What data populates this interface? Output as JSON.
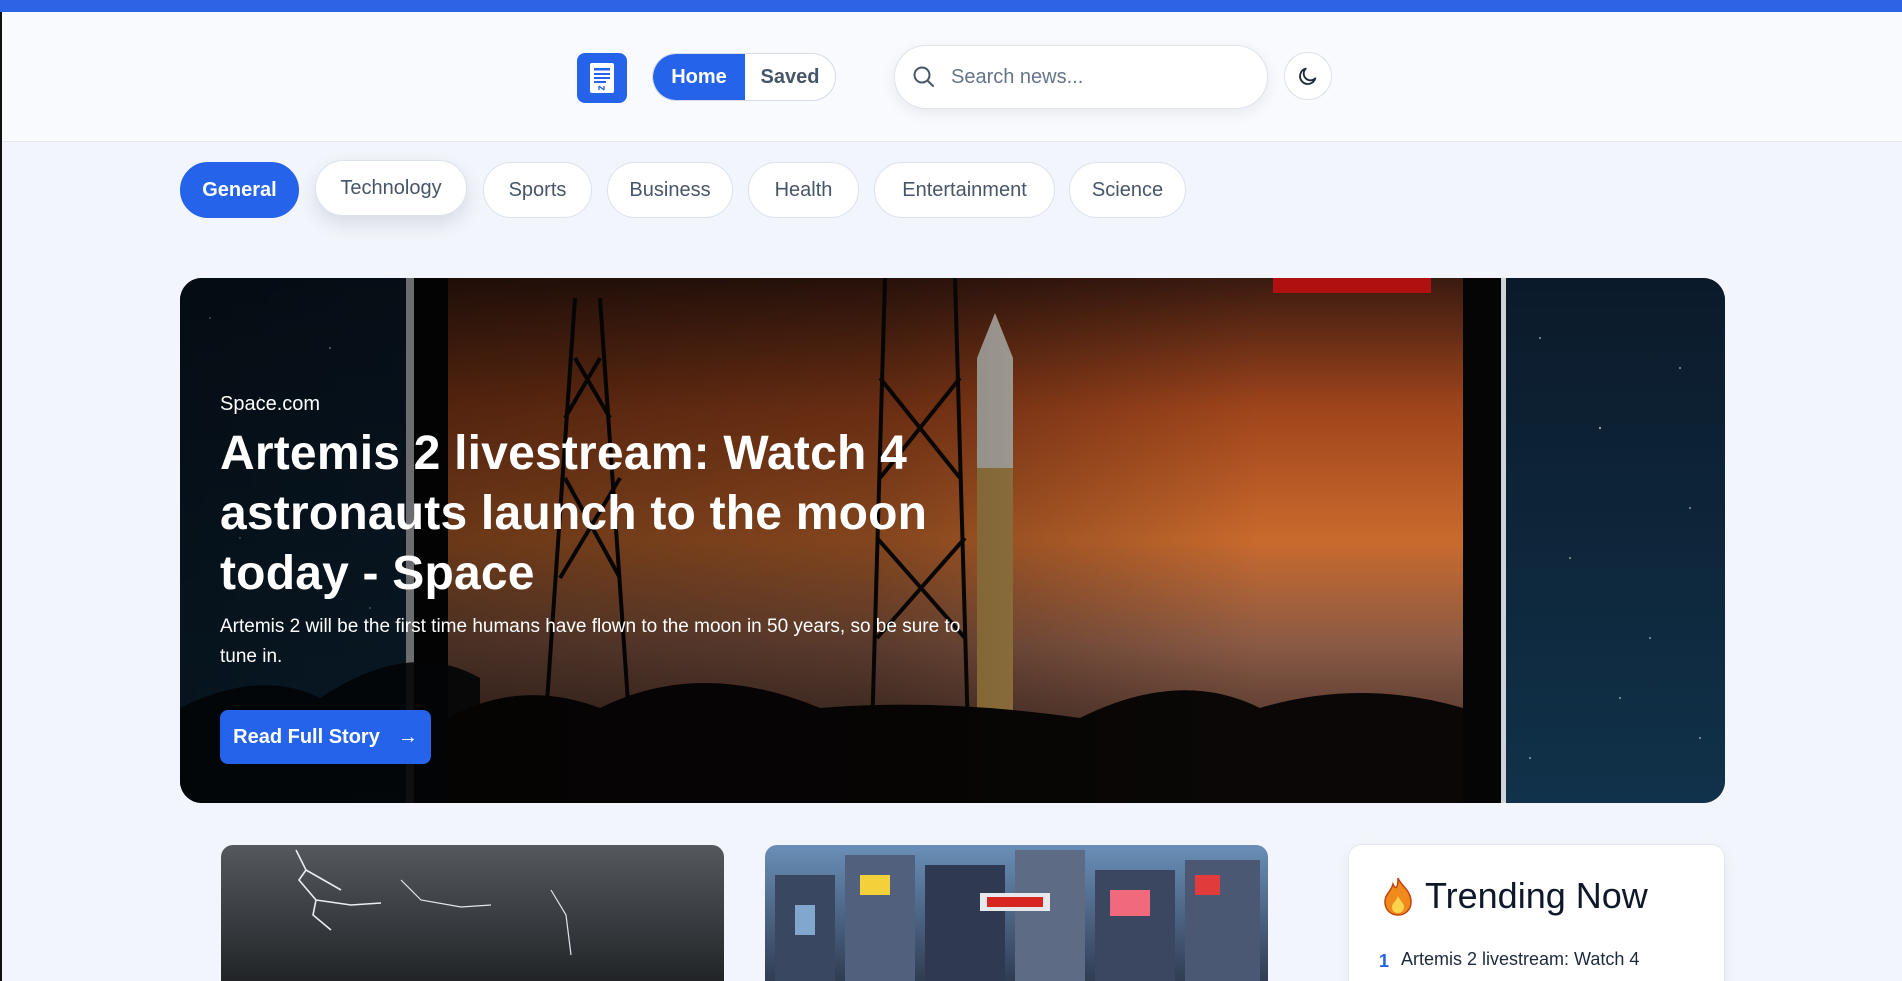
{
  "header": {
    "logo_icon": "newspaper-icon",
    "nav": {
      "home_label": "Home",
      "saved_label": "Saved"
    },
    "search": {
      "placeholder": "Search news...",
      "value": "",
      "icon": "search-icon"
    },
    "theme_toggle_icon": "moon-icon"
  },
  "categories": [
    "General",
    "Technology",
    "Sports",
    "Business",
    "Health",
    "Entertainment",
    "Science"
  ],
  "active_category": "General",
  "hero": {
    "source": "Space.com",
    "title": "Artemis 2 livestream: Watch 4 astronauts launch to the moon today - Space",
    "description": "Artemis 2 will be the first time humans have flown to the moon in 50 years, so be sure to tune in.",
    "cta_label": "Read Full Story",
    "cta_arrow": "→"
  },
  "cards": [
    {
      "image": "lightning-storm-image"
    },
    {
      "image": "city-street-crossing-image"
    }
  ],
  "trending": {
    "icon": "fire-icon",
    "title": "Trending Now",
    "items": [
      {
        "rank": "1",
        "title": "Artemis 2 livestream: Watch 4"
      }
    ]
  },
  "colors": {
    "accent": "#2563eb",
    "top_bar": "#2f63e6",
    "background": "#f2f5fb"
  }
}
